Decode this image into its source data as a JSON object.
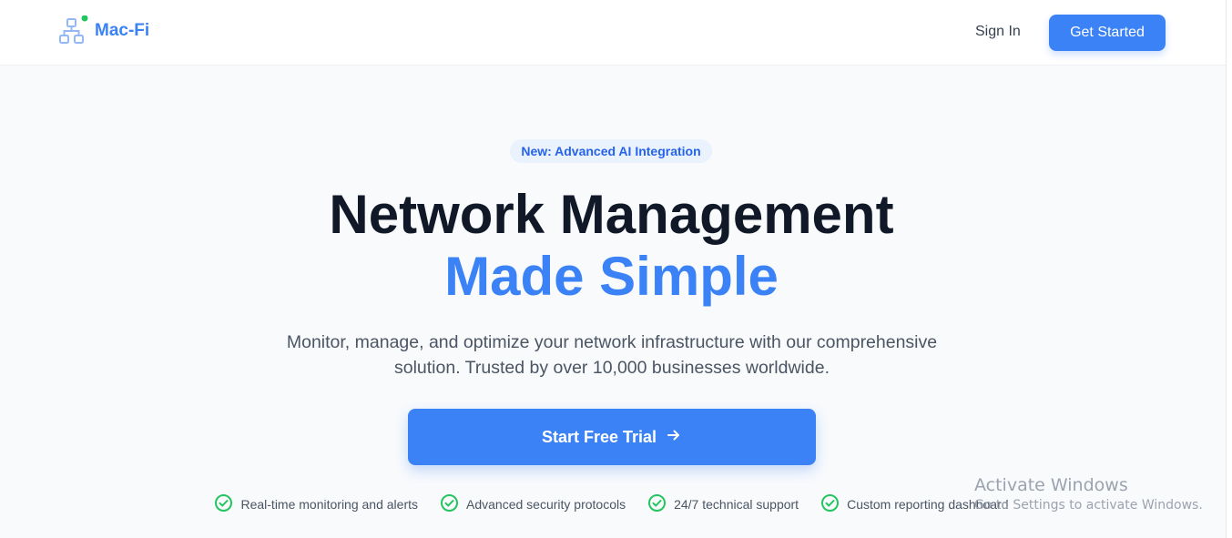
{
  "header": {
    "logo_text": "Mac-Fi",
    "signin_label": "Sign In",
    "get_started_label": "Get Started"
  },
  "hero": {
    "badge": "New: Advanced AI Integration",
    "title_line1": "Network Management",
    "title_line2": "Made Simple",
    "subtitle": "Monitor, manage, and optimize your network infrastructure with our comprehensive solution. Trusted by over 10,000 businesses worldwide.",
    "cta_label": "Start Free Trial"
  },
  "features": [
    {
      "label": "Real-time monitoring and alerts",
      "icon": "check-circle-icon"
    },
    {
      "label": "Advanced security protocols",
      "icon": "check-circle-icon"
    },
    {
      "label": "24/7 technical support",
      "icon": "check-circle-icon"
    },
    {
      "label": "Custom reporting dashboard",
      "icon": "check-circle-icon"
    }
  ],
  "watermark": {
    "line1": "Activate Windows",
    "line2": "Go to Settings to activate Windows."
  },
  "colors": {
    "accent": "#3b82f6",
    "heading": "#111827",
    "check": "#22c55e",
    "status_dot": "#22c55e"
  }
}
